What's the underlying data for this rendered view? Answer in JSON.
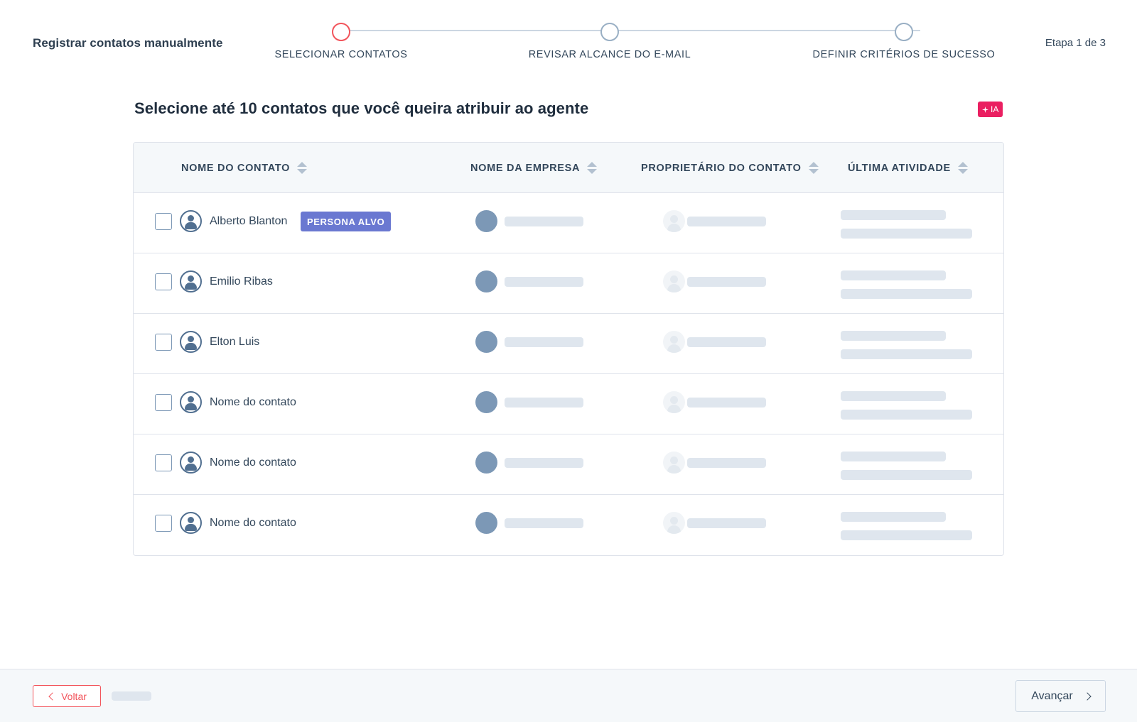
{
  "header": {
    "title": "Registrar contatos manualmente",
    "step_counter": "Etapa 1 de 3",
    "steps": [
      {
        "label": "SELECIONAR CONTATOS",
        "active": true
      },
      {
        "label": "REVISAR ALCANCE DO E-MAIL",
        "active": false
      },
      {
        "label": "DEFINIR CRITÉRIOS DE SUCESSO",
        "active": false
      }
    ]
  },
  "main": {
    "heading": "Selecione até 10 contatos que você queira atribuir ao agente",
    "ai_badge": "IA",
    "ai_badge_icon": "sparkle-icon",
    "accent_color": "#ea1f61"
  },
  "table": {
    "columns": [
      "NOME DO CONTATO",
      "NOME DA EMPRESA",
      "PROPRIETÁRIO DO CONTATO",
      "ÚLTIMA ATIVIDADE"
    ],
    "rows": [
      {
        "name": "Alberto Blanton",
        "tag": "PERSONA ALVO",
        "checked": false
      },
      {
        "name": "Emilio Ribas",
        "tag": "",
        "checked": false
      },
      {
        "name": "Elton Luis",
        "tag": "",
        "checked": false
      },
      {
        "name": "Nome do contato",
        "tag": "",
        "checked": false
      },
      {
        "name": "Nome do contato",
        "tag": "",
        "checked": false
      },
      {
        "name": "Nome do contato",
        "tag": "",
        "checked": false
      }
    ],
    "tag_color": "#6a78d1"
  },
  "footer": {
    "back_label": "Voltar",
    "next_label": "Avançar",
    "back_color": "#f2545b"
  }
}
